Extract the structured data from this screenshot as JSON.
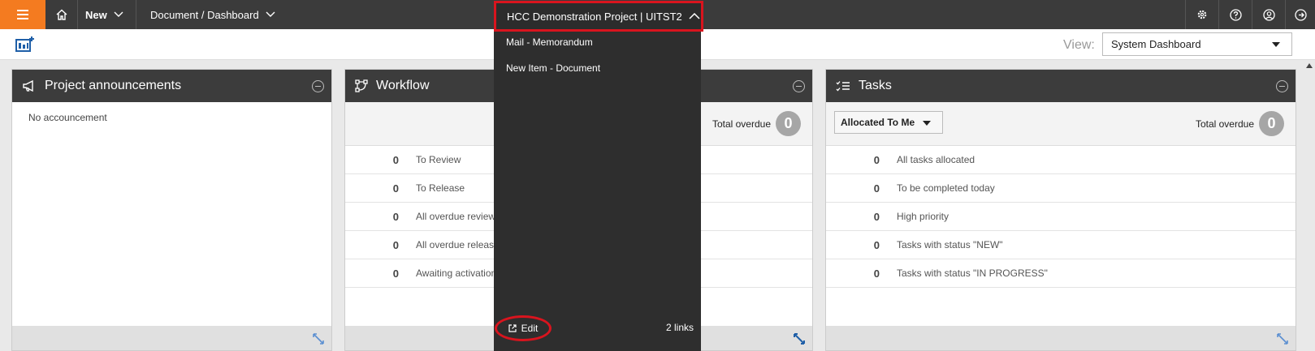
{
  "topbar": {
    "new_label": "New",
    "nav_label": "Document / Dashboard",
    "project_label": "HCC Demonstration Project | UITST2"
  },
  "subbar": {
    "view_label": "View:",
    "view_value": "System Dashboard"
  },
  "announcements": {
    "title": "Project announcements",
    "empty_text": "No accouncement"
  },
  "workflow": {
    "title": "Workflow",
    "overdue_label": "Total overdue",
    "overdue_count": "0",
    "rows": [
      {
        "count": "0",
        "label": "To Review"
      },
      {
        "count": "0",
        "label": "To Release"
      },
      {
        "count": "0",
        "label": "All overdue reviews"
      },
      {
        "count": "0",
        "label": "All overdue releases"
      },
      {
        "count": "0",
        "label": "Awaiting activation"
      }
    ]
  },
  "tasks": {
    "title": "Tasks",
    "filter_value": "Allocated To Me",
    "overdue_label": "Total overdue",
    "overdue_count": "0",
    "rows": [
      {
        "count": "0",
        "label": "All tasks allocated"
      },
      {
        "count": "0",
        "label": "To be completed today"
      },
      {
        "count": "0",
        "label": "High priority"
      },
      {
        "count": "0",
        "label": "Tasks with status \"NEW\""
      },
      {
        "count": "0",
        "label": "Tasks with status \"IN PROGRESS\""
      }
    ]
  },
  "project_menu": {
    "items": [
      "Mail - Memorandum",
      "New Item - Document"
    ],
    "edit_label": "Edit",
    "links_count": "2 links"
  },
  "colors": {
    "accent": "#f47b20",
    "highlight": "#d9141e",
    "bar": "#3b3b3b"
  }
}
